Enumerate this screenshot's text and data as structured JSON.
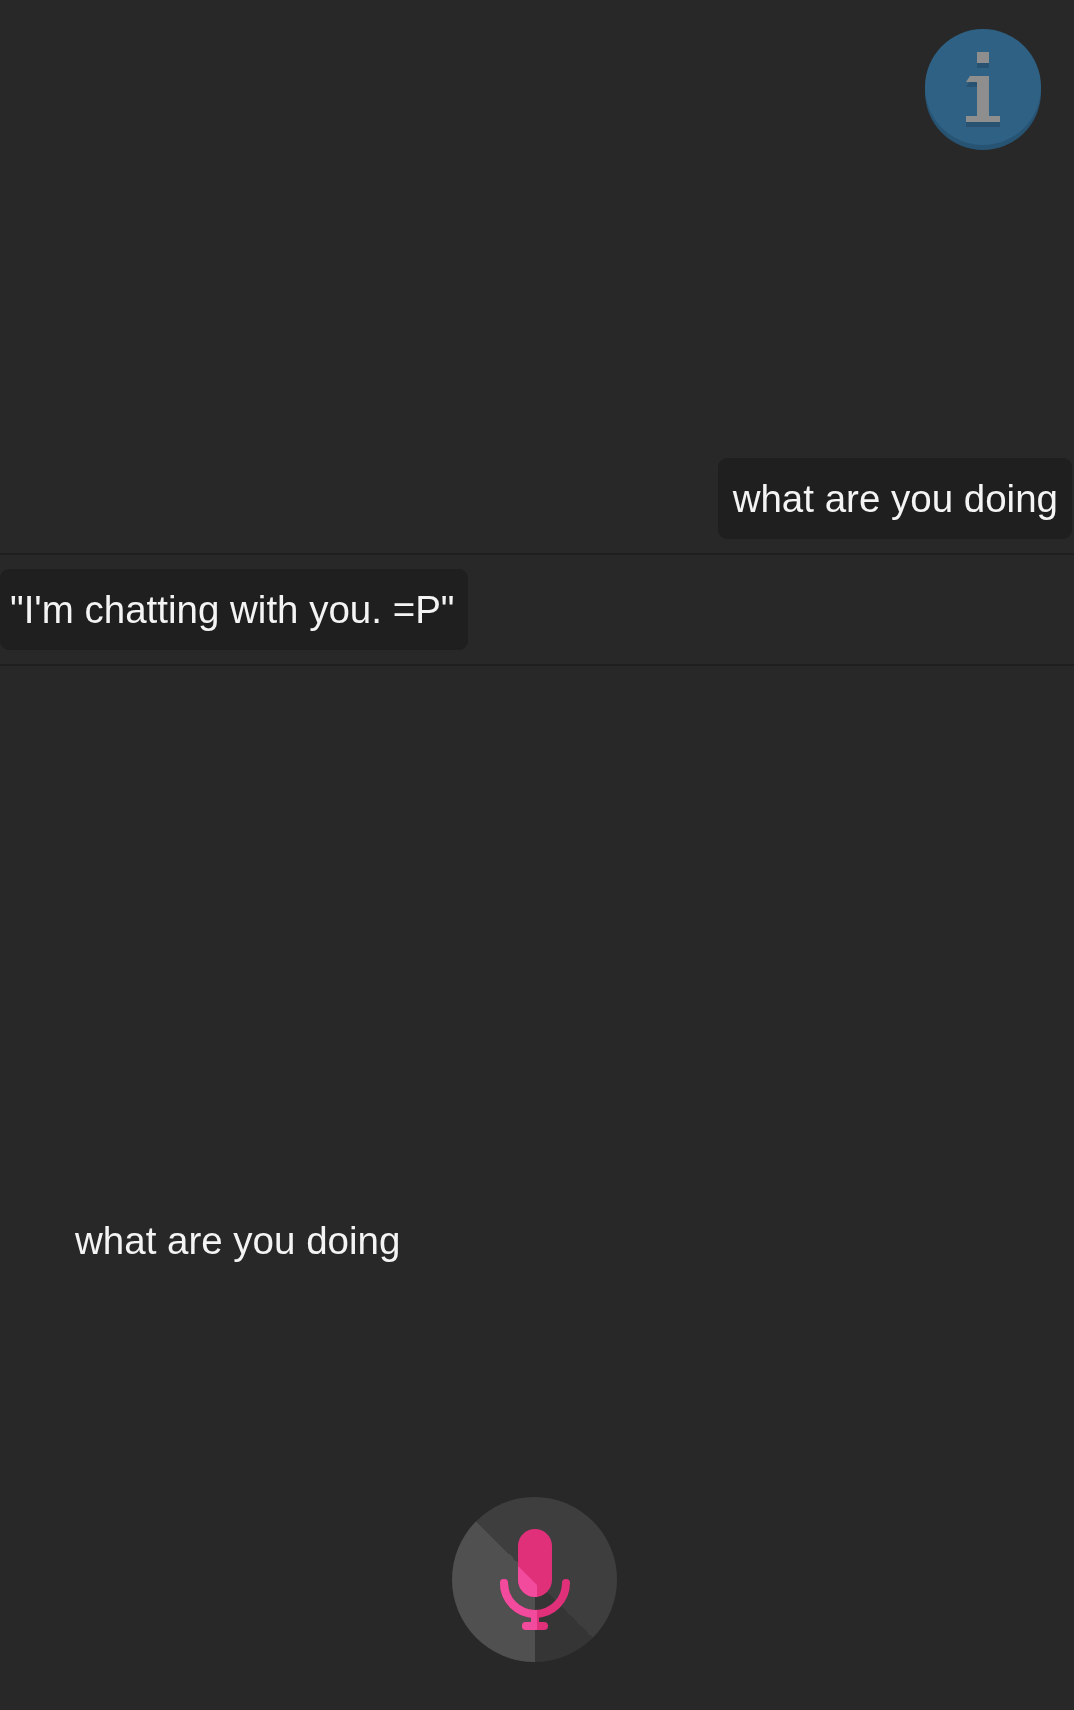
{
  "messages": [
    {
      "kind": "sent",
      "text": "what are you doing"
    },
    {
      "kind": "received",
      "text": "\"I'm chatting with you. =P\""
    }
  ],
  "transcript": {
    "text": "what are you doing"
  }
}
